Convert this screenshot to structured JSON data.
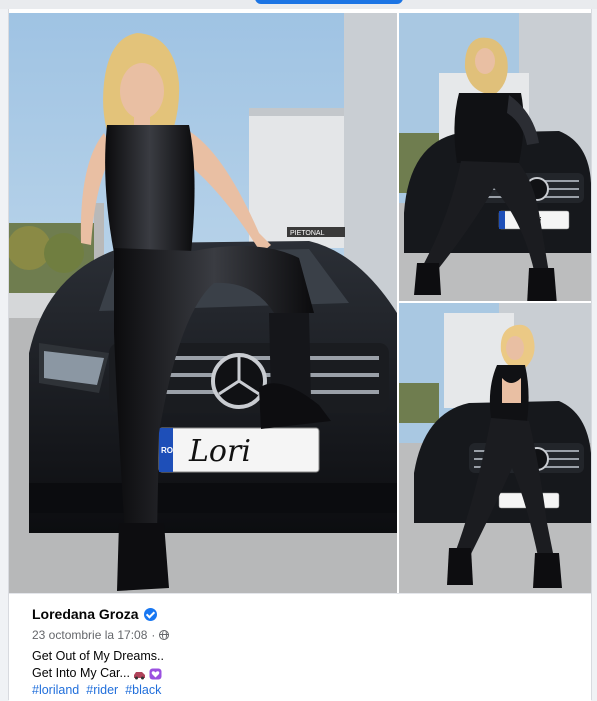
{
  "post": {
    "author": "Loredana Groza",
    "timestamp": "23 octombrie la 17:08",
    "separator": "·",
    "text_lines": [
      "Get Out of My Dreams..",
      "Get Into My Car..."
    ],
    "hashtags": [
      "#loriland",
      "#rider",
      "#black"
    ]
  },
  "photos": {
    "plate_text": "Lori",
    "plate_country": "RO",
    "sign_text": "PIETONAL"
  },
  "icons": {
    "verified": "verified-badge-icon",
    "audience": "globe-icon",
    "emoji_1": "car-emoji-icon",
    "emoji_2": "purple-heart-emoji-icon"
  },
  "colors": {
    "link": "#216fdb",
    "verified": "#1877f2",
    "muted": "#65676b"
  }
}
